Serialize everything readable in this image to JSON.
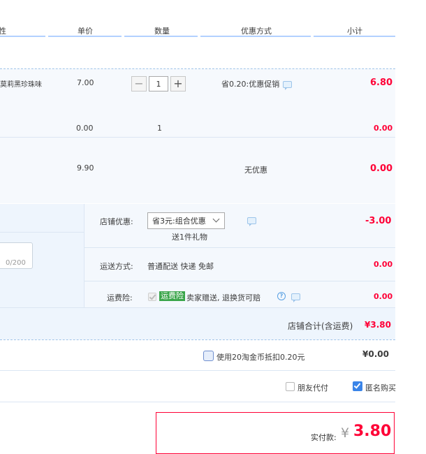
{
  "header": {
    "col_attr_partial": "性",
    "col_price": "单价",
    "col_qty": "数量",
    "col_discount": "优惠方式",
    "col_subtotal": "小计"
  },
  "items": [
    {
      "name_partial": "莫莉黑珍珠味",
      "price": "7.00",
      "quantity": "1",
      "discount": "省0.20:优惠促销",
      "subtotal": "6.80"
    },
    {
      "price": "0.00",
      "quantity": "1",
      "subtotal": "0.00"
    },
    {
      "price": "9.90",
      "discount": "无优惠",
      "subtotal": "0.00"
    }
  ],
  "message": {
    "counter": "0/200"
  },
  "shop": {
    "discount_label": "店铺优惠:",
    "discount_selected": "省3元:组合优惠",
    "gift_text": "送1件礼物",
    "discount_amount": "-3.00",
    "shipping_label": "运送方式:",
    "shipping_value": "普通配送 快递 免邮",
    "shipping_amount": "0.00",
    "insurance_label": "运费险:",
    "insurance_badge": "运费险",
    "insurance_text": "卖家赠送, 退换货可赔",
    "insurance_amount": "0.00",
    "total_label": "店铺合计(含运费)",
    "total_amount": "¥3.80"
  },
  "coins": {
    "label": "使用20淘金币抵扣0.20元",
    "amount": "¥0.00"
  },
  "options": {
    "friend_pay": "朋友代付",
    "anonymous": "匿名购买"
  },
  "payment": {
    "label": "实付款:",
    "currency": "¥",
    "amount": "3.80"
  },
  "colors": {
    "accent_red": "#ff0036",
    "row_bg": "#f6f9fd",
    "shop_bg": "#eef5fd",
    "header_line": "#b2d1ff"
  }
}
